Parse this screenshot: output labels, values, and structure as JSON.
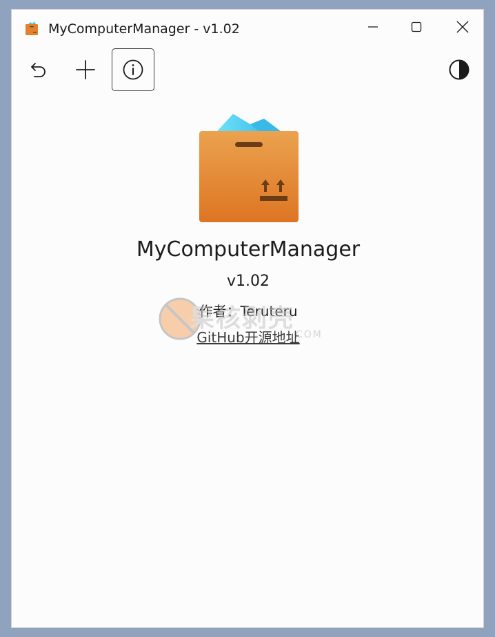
{
  "window": {
    "title": "MyComputerManager - v1.02"
  },
  "toolbar": {
    "undo_icon": "undo-icon",
    "add_icon": "add-icon",
    "info_icon": "info-icon",
    "theme_icon": "theme-contrast-icon"
  },
  "about": {
    "app_name": "MyComputerManager",
    "version": "v1.02",
    "author": "作者：Teruteru",
    "link": "GitHub开源地址"
  },
  "watermark": {
    "text": "果核剥壳",
    "sub": "COM"
  },
  "colors": {
    "box_orange": "#e2822e",
    "box_orange_light": "#eba24e",
    "paper_blue": "#43c6ef",
    "paper_blue_light": "#6fe0f8",
    "window_bg": "#fcfcfd",
    "frame_bg": "#8fa2be"
  }
}
